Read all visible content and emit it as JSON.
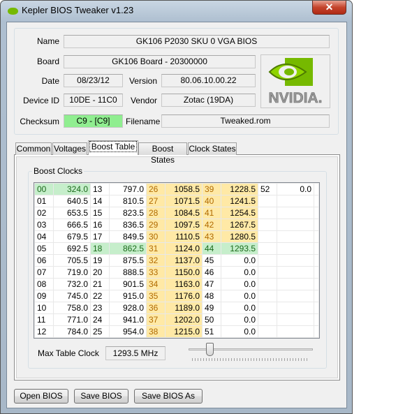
{
  "window": {
    "title": "Kepler BIOS Tweaker v1.23",
    "close": "✕"
  },
  "info": {
    "name_label": "Name",
    "name": "GK106 P2030 SKU 0 VGA BIOS",
    "board_label": "Board",
    "board": "GK106 Board - 20300000",
    "date_label": "Date",
    "date": "08/23/12",
    "version_label": "Version",
    "version": "80.06.10.00.22",
    "device_label": "Device ID",
    "device": "10DE - 11C0",
    "vendor_label": "Vendor",
    "vendor": "Zotac (19DA)",
    "checksum_label": "Checksum",
    "checksum": "C9 - [C9]",
    "checksum_color": "#90ee90",
    "filename_label": "Filename",
    "filename": "Tweaked.rom",
    "logo_text": "NVIDIA."
  },
  "tabs": [
    {
      "label": "Common"
    },
    {
      "label": "Voltages"
    },
    {
      "label": "Boost Table",
      "selected": true
    },
    {
      "label": "Boost States"
    },
    {
      "label": "Clock States"
    }
  ],
  "boost": {
    "group_label": "Boost Clocks",
    "columns": [
      [
        [
          "00",
          "324.0",
          "g"
        ],
        [
          "01",
          "640.5",
          ""
        ],
        [
          "02",
          "653.5",
          ""
        ],
        [
          "03",
          "666.5",
          ""
        ],
        [
          "04",
          "679.5",
          ""
        ],
        [
          "05",
          "692.5",
          ""
        ],
        [
          "06",
          "705.5",
          ""
        ],
        [
          "07",
          "719.0",
          ""
        ],
        [
          "08",
          "732.0",
          ""
        ],
        [
          "09",
          "745.0",
          ""
        ],
        [
          "10",
          "758.0",
          ""
        ],
        [
          "11",
          "771.0",
          ""
        ],
        [
          "12",
          "784.0",
          ""
        ]
      ],
      [
        [
          "13",
          "797.0",
          ""
        ],
        [
          "14",
          "810.5",
          ""
        ],
        [
          "15",
          "823.5",
          ""
        ],
        [
          "16",
          "836.5",
          ""
        ],
        [
          "17",
          "849.5",
          ""
        ],
        [
          "18",
          "862.5",
          "g"
        ],
        [
          "19",
          "875.5",
          ""
        ],
        [
          "20",
          "888.5",
          ""
        ],
        [
          "21",
          "901.5",
          ""
        ],
        [
          "22",
          "915.0",
          ""
        ],
        [
          "23",
          "928.0",
          ""
        ],
        [
          "24",
          "941.0",
          ""
        ],
        [
          "25",
          "954.0",
          ""
        ]
      ],
      [
        [
          "26",
          "1058.5",
          "y"
        ],
        [
          "27",
          "1071.5",
          "y"
        ],
        [
          "28",
          "1084.5",
          "y"
        ],
        [
          "29",
          "1097.5",
          "y"
        ],
        [
          "30",
          "1110.5",
          "y"
        ],
        [
          "31",
          "1124.0",
          "y"
        ],
        [
          "32",
          "1137.0",
          "y"
        ],
        [
          "33",
          "1150.0",
          "y"
        ],
        [
          "34",
          "1163.0",
          "y"
        ],
        [
          "35",
          "1176.0",
          "y"
        ],
        [
          "36",
          "1189.0",
          "y"
        ],
        [
          "37",
          "1202.0",
          "y"
        ],
        [
          "38",
          "1215.0",
          "y"
        ]
      ],
      [
        [
          "39",
          "1228.5",
          "y"
        ],
        [
          "40",
          "1241.5",
          "y"
        ],
        [
          "41",
          "1254.5",
          "y"
        ],
        [
          "42",
          "1267.5",
          "y"
        ],
        [
          "43",
          "1280.5",
          "y"
        ],
        [
          "44",
          "1293.5",
          "g"
        ],
        [
          "45",
          "0.0",
          ""
        ],
        [
          "46",
          "0.0",
          ""
        ],
        [
          "47",
          "0.0",
          ""
        ],
        [
          "48",
          "0.0",
          ""
        ],
        [
          "49",
          "0.0",
          ""
        ],
        [
          "50",
          "0.0",
          ""
        ],
        [
          "51",
          "0.0",
          ""
        ]
      ],
      [
        [
          "52",
          "0.0",
          ""
        ]
      ]
    ],
    "max_label": "Max Table Clock",
    "max_value": "1293.5 MHz",
    "slider_fraction": 0.17
  },
  "buttons": {
    "open": "Open BIOS",
    "save": "Save BIOS",
    "save_as": "Save BIOS As"
  },
  "colors": {
    "highlight_yellow": "#ffe9a6",
    "highlight_green": "#c6eecb",
    "nvidia_green": "#76b900"
  }
}
